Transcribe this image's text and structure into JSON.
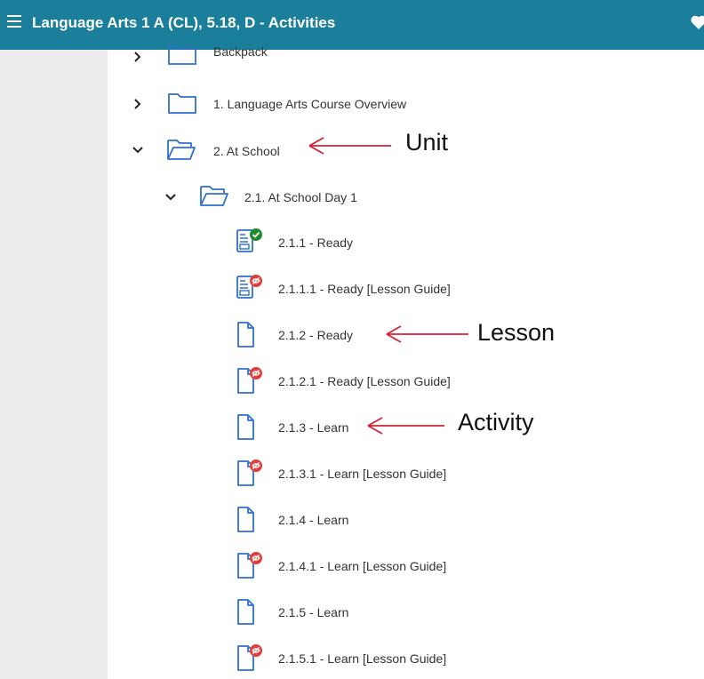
{
  "header": {
    "title": "Language Arts 1 A (CL), 5.18, D - Activities",
    "bg": "#1b7f9c"
  },
  "tree": {
    "folders": [
      {
        "label": "Backpack",
        "expanded": false
      },
      {
        "label": "1. Language Arts Course Overview",
        "expanded": false
      },
      {
        "label": "2. At School",
        "expanded": true
      },
      {
        "label": "2.1. At School Day 1",
        "expanded": true
      }
    ],
    "items": [
      {
        "label": "2.1.1 - Ready",
        "icon": "checklist-doc-icon",
        "badge": "check"
      },
      {
        "label": "2.1.1.1 - Ready [Lesson Guide]",
        "icon": "checklist-doc-icon",
        "badge": "hidden"
      },
      {
        "label": "2.1.2 - Ready",
        "icon": "doc-icon",
        "badge": ""
      },
      {
        "label": "2.1.2.1 - Ready [Lesson Guide]",
        "icon": "doc-icon",
        "badge": "hidden"
      },
      {
        "label": "2.1.3 - Learn",
        "icon": "doc-icon",
        "badge": ""
      },
      {
        "label": "2.1.3.1 - Learn [Lesson Guide]",
        "icon": "doc-icon",
        "badge": "hidden"
      },
      {
        "label": "2.1.4 - Learn",
        "icon": "doc-icon",
        "badge": ""
      },
      {
        "label": "2.1.4.1 - Learn [Lesson Guide]",
        "icon": "doc-icon",
        "badge": "hidden"
      },
      {
        "label": "2.1.5 - Learn",
        "icon": "doc-icon",
        "badge": ""
      },
      {
        "label": "2.1.5.1 - Learn [Lesson Guide]",
        "icon": "doc-icon",
        "badge": "hidden"
      }
    ]
  },
  "annotations": {
    "unit": "Unit",
    "lesson": "Lesson",
    "activity": "Activity"
  },
  "colors": {
    "icon_blue": "#2f6fd0",
    "check_green": "#1f8a2c",
    "hidden_red": "#e0403c",
    "arrow_red": "#d0243a"
  }
}
